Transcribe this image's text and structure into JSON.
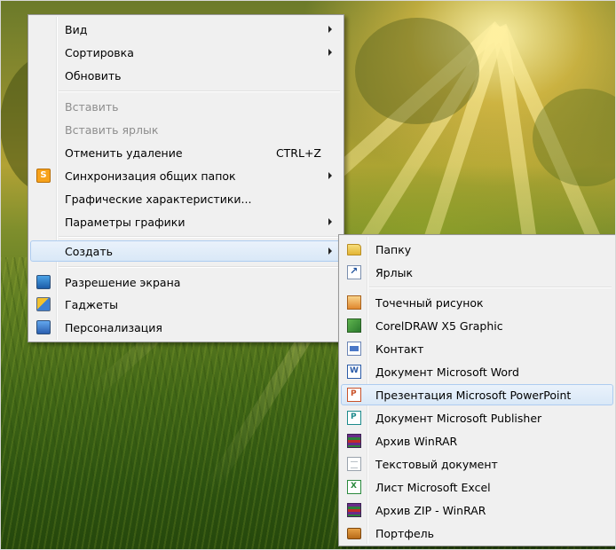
{
  "main_menu": {
    "items": [
      {
        "label": "Вид",
        "submenu": true
      },
      {
        "label": "Сортировка",
        "submenu": true
      },
      {
        "label": "Обновить"
      },
      {
        "label": "Вставить",
        "disabled": true
      },
      {
        "label": "Вставить ярлык",
        "disabled": true
      },
      {
        "label": "Отменить удаление",
        "shortcut": "CTRL+Z"
      },
      {
        "label": "Синхронизация общих папок",
        "icon": "sync-icon",
        "submenu": true
      },
      {
        "label": "Графические характеристики..."
      },
      {
        "label": "Параметры графики",
        "submenu": true
      },
      {
        "label": "Создать",
        "submenu": true,
        "highlighted": true
      },
      {
        "label": "Разрешение экрана",
        "icon": "screen-resolution-icon"
      },
      {
        "label": "Гаджеты",
        "icon": "gadgets-icon"
      },
      {
        "label": "Персонализация",
        "icon": "personalization-icon"
      }
    ]
  },
  "create_submenu": {
    "items": [
      {
        "label": "Папку",
        "icon": "folder-icon"
      },
      {
        "label": "Ярлык",
        "icon": "shortcut-icon"
      },
      {
        "label": "Точечный рисунок",
        "icon": "bitmap-icon"
      },
      {
        "label": "CorelDRAW X5 Graphic",
        "icon": "coreldraw-icon"
      },
      {
        "label": "Контакт",
        "icon": "contact-icon"
      },
      {
        "label": "Документ Microsoft Word",
        "icon": "word-document-icon"
      },
      {
        "label": "Презентация Microsoft PowerPoint",
        "icon": "powerpoint-icon",
        "highlighted": true
      },
      {
        "label": "Документ Microsoft Publisher",
        "icon": "publisher-icon"
      },
      {
        "label": "Архив WinRAR",
        "icon": "winrar-icon"
      },
      {
        "label": "Текстовый документ",
        "icon": "text-document-icon"
      },
      {
        "label": "Лист Microsoft Excel",
        "icon": "excel-icon"
      },
      {
        "label": "Архив ZIP - WinRAR",
        "icon": "winrar-zip-icon"
      },
      {
        "label": "Портфель",
        "icon": "briefcase-icon"
      }
    ]
  }
}
